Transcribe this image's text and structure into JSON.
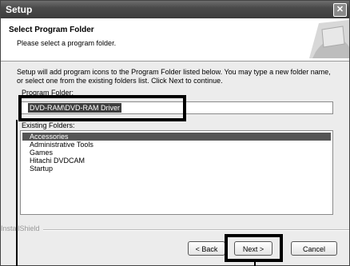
{
  "window": {
    "title": "Setup",
    "close_glyph": "✕"
  },
  "header": {
    "title": "Select Program Folder",
    "subtitle": "Please select a program folder."
  },
  "body": {
    "description": "Setup will add program icons to the Program Folder listed below.  You may type a new folder name, or select one from the existing folders list.  Click Next to continue.",
    "program_folder_label": "Program Folder:",
    "program_folder_value": "DVD-RAM\\DVD-RAM Driver",
    "existing_folders_label": "Existing Folders:",
    "existing_folders": [
      {
        "label": "Accessories",
        "selected": true
      },
      {
        "label": "Administrative Tools",
        "selected": false
      },
      {
        "label": "Games",
        "selected": false
      },
      {
        "label": "Hitachi DVDCAM",
        "selected": false
      },
      {
        "label": "Startup",
        "selected": false
      }
    ]
  },
  "footer": {
    "brand": "InstallShield",
    "back_label": "< Back",
    "next_label": "Next >",
    "cancel_label": "Cancel"
  }
}
